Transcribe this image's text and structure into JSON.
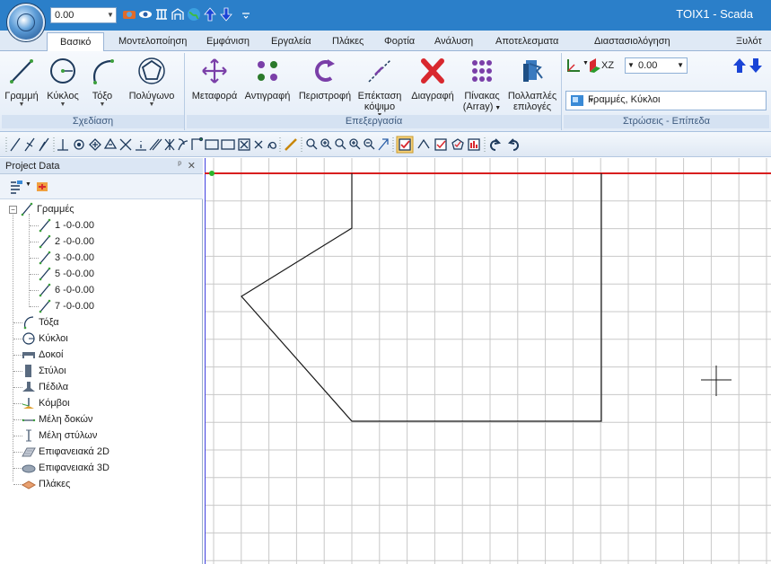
{
  "window": {
    "title": "TOIX1 - Scada",
    "quick_access_elevation": "0.00"
  },
  "colors": {
    "title_bar": "#2b7fc9",
    "axis_x": "#d81e1e",
    "axis_y": "#4040e0",
    "origin": "#2bb52b"
  },
  "tabs": [
    "Βασικό",
    "Μοντελοποίηση",
    "Εμφάνιση",
    "Εργαλεία",
    "Πλάκες",
    "Φορτία",
    "Ανάλυση",
    "Αποτελεσματα",
    "Διαστασιολόγηση",
    "Ξυλότ"
  ],
  "ribbon": {
    "draw_group": {
      "label": "Σχεδίαση",
      "buttons": [
        "Γραμμή",
        "Κύκλος",
        "Τόξο",
        "Πολύγωνο"
      ]
    },
    "edit_group": {
      "label": "Επεξεργασία",
      "buttons": [
        {
          "line1": "Μεταφορά",
          "line2": ""
        },
        {
          "line1": "Αντιγραφή",
          "line2": ""
        },
        {
          "line1": "Περιστροφή",
          "line2": ""
        },
        {
          "line1": "Επέκταση",
          "line2": "κόψιμο"
        },
        {
          "line1": "Διαγραφή",
          "line2": ""
        },
        {
          "line1": "Πίνακας",
          "line2": "(Array)"
        },
        {
          "line1": "Πολλαπλές",
          "line2": "επιλογές"
        }
      ]
    },
    "layers_group": {
      "label": "Στρώσεις - Επίπεδα",
      "plane": "XZ",
      "elevation": "0.00",
      "layer": "Γραμμές, Κύκλοι"
    }
  },
  "panel": {
    "title": "Project Data",
    "tree": {
      "lines": {
        "label": "Γραμμές",
        "children": [
          "1 -0-0.00",
          "2 -0-0.00",
          "3 -0-0.00",
          "5 -0-0.00",
          "6 -0-0.00",
          "7 -0-0.00"
        ]
      },
      "others": [
        "Τόξα",
        "Κύκλοι",
        "Δοκοί",
        "Στύλοι",
        "Πέδιλα",
        "Κόμβοι",
        "Μέλη δοκών",
        "Μέλη στύλων",
        "Επιφανειακά 2D",
        "Επιφανειακά 3D",
        "Πλάκες"
      ]
    }
  }
}
